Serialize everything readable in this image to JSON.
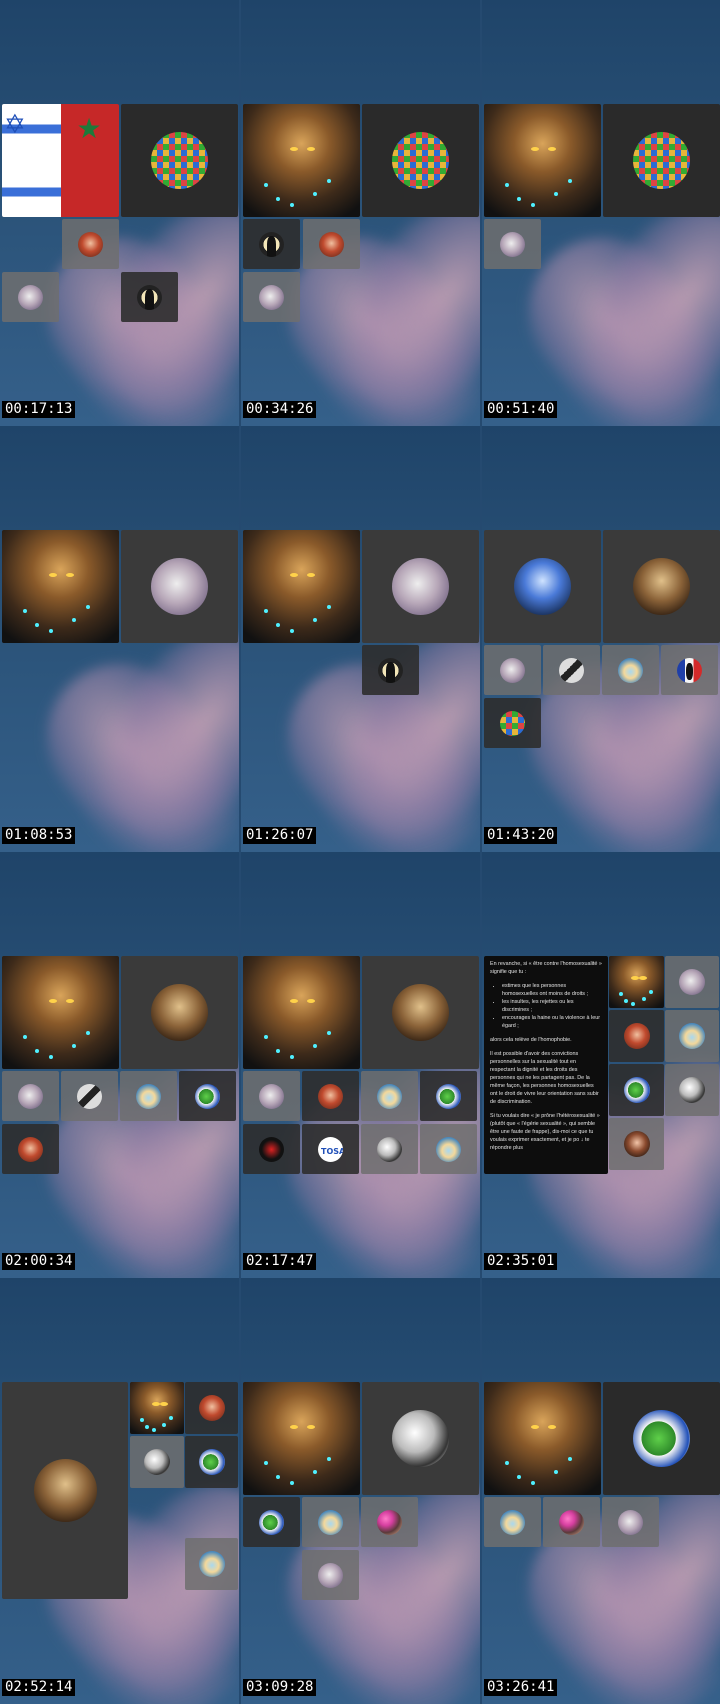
{
  "timestamps": [
    "00:17:13",
    "00:34:26",
    "00:51:40",
    "01:08:53",
    "01:26:07",
    "01:43:20",
    "02:00:34",
    "02:17:47",
    "02:35:01",
    "02:52:14",
    "03:09:28",
    "03:26:41"
  ],
  "avatars": {
    "flags": "israel-morocco-flags-avatar",
    "lion": "muscular-lion-avatar",
    "grid": "colorful-grid-avatar",
    "cat": "cat-avatar",
    "shadow": "shadow-figure-avatar",
    "red": "red-portrait-avatar",
    "bluelion": "blue-lion-avatar",
    "brownlion": "lion-portrait-avatar",
    "pen": "pen-avatar",
    "island": "island-avatar",
    "fr": "french-flag-avatar",
    "dragon": "dragon-flag-avatar",
    "silk": "silk-avatar",
    "woman": "woman-avatar",
    "pink": "pink-flower-avatar",
    "redfig": "red-figure-avatar",
    "logo": "tosaf-logo-avatar"
  },
  "chat_panel": {
    "intro": "En revanche, si « être contre l'homosexualité » signifie que tu :",
    "bullets": [
      "estimes que les personnes homosexuelles ont moins de droits ;",
      "les insultes, les rejettes ou les discrimines ;",
      "encourages la haine ou la violence à leur égard ;"
    ],
    "conclusion": "alors cela relève de l'homophobie.",
    "paragraph2": "Il est possible d'avoir des convictions personnelles sur la sexualité tout en respectant la dignité et les droits des personnes qui ne les partagent pas. De la même façon, les personnes homosexuelles ont le droit de vivre leur orientation sans subir de discrimination.",
    "paragraph3": "Si tu voulais dire « je prône l'hétérosexualité » (plutôt que « l'égérie sexualité », qui semble être une faute de frappe), dis-moi ce que tu voulais exprimer exactement, et je po",
    "paragraph3_end": "te répondre plus"
  },
  "colors": {
    "background": "#254a70",
    "tile_dark": "#2a2a2a",
    "tile_gray": "#6e6e6e",
    "timestamp_bg": "#000000",
    "timestamp_fg": "#ffffff"
  }
}
